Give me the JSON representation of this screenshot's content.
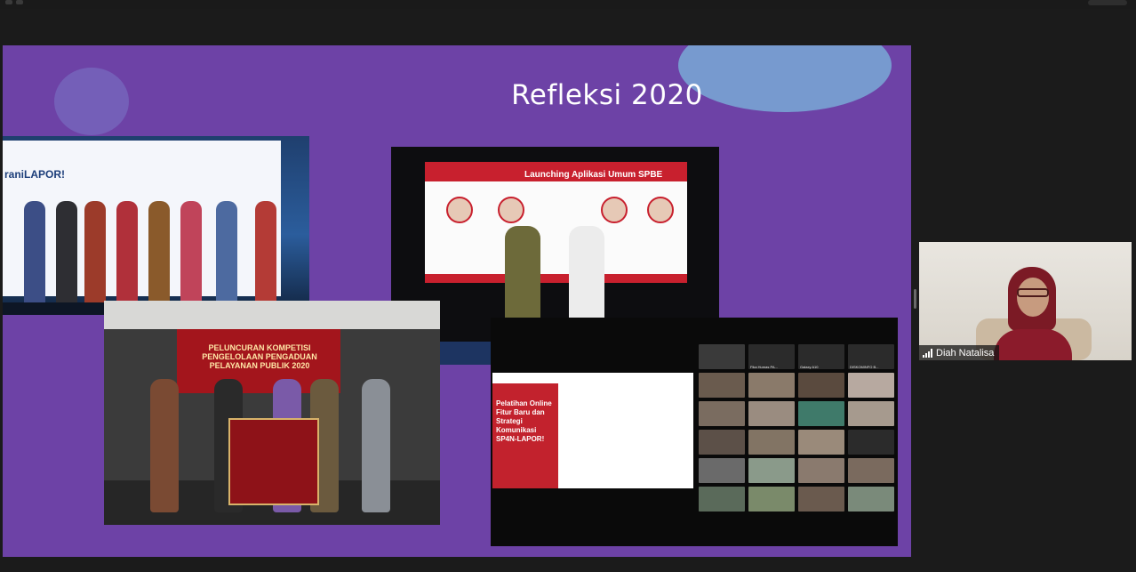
{
  "meeting": {
    "slide_title": "Refleksi 2020",
    "slide_bg": "#6d42a6"
  },
  "photos": {
    "event1_banner": "raniLAPOR!",
    "event2_screen_title": "Launching Aplikasi Umum SPBE",
    "event3_banner": "PELUNCURAN KOMPETISI PENGELOLAAN PENGADUAN PELAYANAN PUBLIK 2020",
    "event4_card_title": "Pelatihan Online Fitur Baru dan Strategi Komunikasi SP4N-LAPOR!"
  },
  "video_grid": {
    "tiles": [
      "Fika Humas PA...",
      "Galaxy A10",
      "DISKOMINFO B..."
    ]
  },
  "participant": {
    "name": "Diah Natalisa",
    "icon": "signal-strength-icon"
  }
}
